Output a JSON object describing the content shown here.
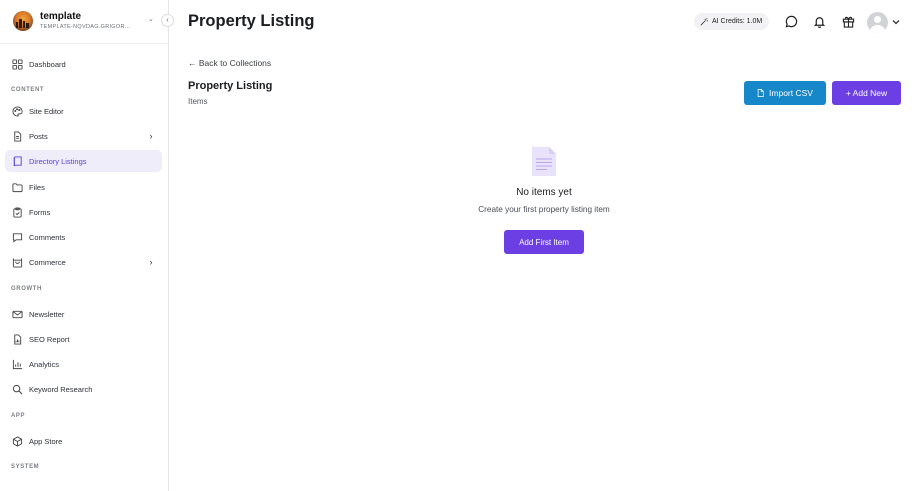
{
  "brand": {
    "name": "template",
    "subtitle": "TEMPLATE-NQVDAG.GRIGOR..."
  },
  "sidebar": {
    "collapse_icon": "chevron-left-icon",
    "items": [
      {
        "label": "Dashboard",
        "icon": "grid-icon"
      },
      {
        "label": "Site Editor",
        "icon": "palette-icon"
      },
      {
        "label": "Posts",
        "icon": "document-icon",
        "has_submenu": true
      },
      {
        "label": "Directory Listings",
        "icon": "book-icon",
        "active": true
      },
      {
        "label": "Files",
        "icon": "folder-icon"
      },
      {
        "label": "Forms",
        "icon": "clipboard-icon"
      },
      {
        "label": "Comments",
        "icon": "comment-icon"
      },
      {
        "label": "Commerce",
        "icon": "shopping-bag-icon",
        "has_submenu": true
      },
      {
        "label": "Newsletter",
        "icon": "mail-icon"
      },
      {
        "label": "SEO Report",
        "icon": "report-icon"
      },
      {
        "label": "Analytics",
        "icon": "bar-chart-icon"
      },
      {
        "label": "Keyword Research",
        "icon": "search-icon"
      },
      {
        "label": "App Store",
        "icon": "box-icon"
      }
    ],
    "sections": {
      "content": "CONTENT",
      "growth": "GROWTH",
      "app": "APP",
      "system": "SYSTEM"
    }
  },
  "header": {
    "title": "Property Listing",
    "credits_label": "AI Credits: 1.0M",
    "icons": [
      "chat-icon",
      "bell-icon",
      "gift-icon",
      "avatar",
      "chevron-down-icon"
    ]
  },
  "main": {
    "back_link": "← Back to Collections",
    "section_title": "Property Listing",
    "section_subtitle": "Items",
    "import_button": "Import CSV",
    "add_button": "+ Add New",
    "empty_state": {
      "title": "No items yet",
      "description": "Create your first property listing item",
      "button": "Add First Item"
    }
  },
  "colors": {
    "accent": "#6b3fe4",
    "import_blue": "#1687c8",
    "active_bg": "#f0edfb",
    "active_text": "#5b3fd0"
  }
}
